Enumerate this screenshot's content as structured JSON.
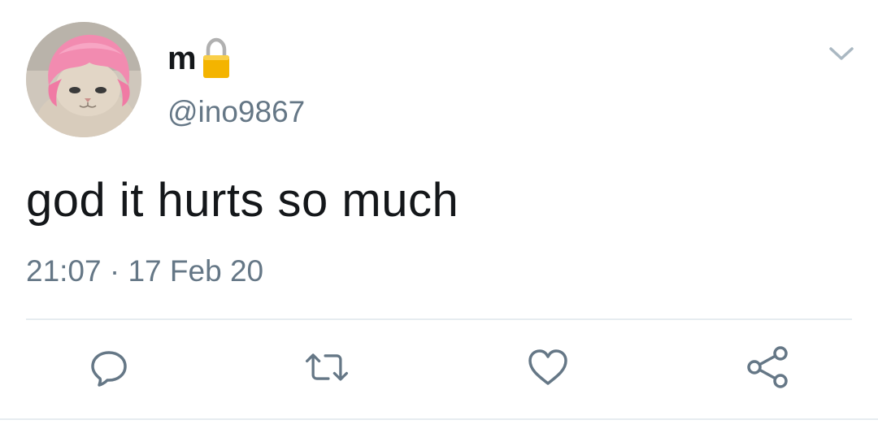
{
  "author": {
    "display_name": "m",
    "handle": "@ino9867",
    "avatar_icon": "avatar-cat-pink-wig",
    "protected_icon": "lock-icon"
  },
  "tweet": {
    "text": "god it hurts so much",
    "time": "21:07",
    "separator": "·",
    "date": "17 Feb 20"
  },
  "actions": {
    "reply_icon": "reply-icon",
    "retweet_icon": "retweet-icon",
    "like_icon": "heart-icon",
    "share_icon": "share-icon",
    "menu_icon": "chevron-down-icon"
  },
  "colors": {
    "text_primary": "#14171a",
    "text_secondary": "#657786",
    "divider": "#e6ecf0",
    "lock_gold": "#f4b400"
  }
}
